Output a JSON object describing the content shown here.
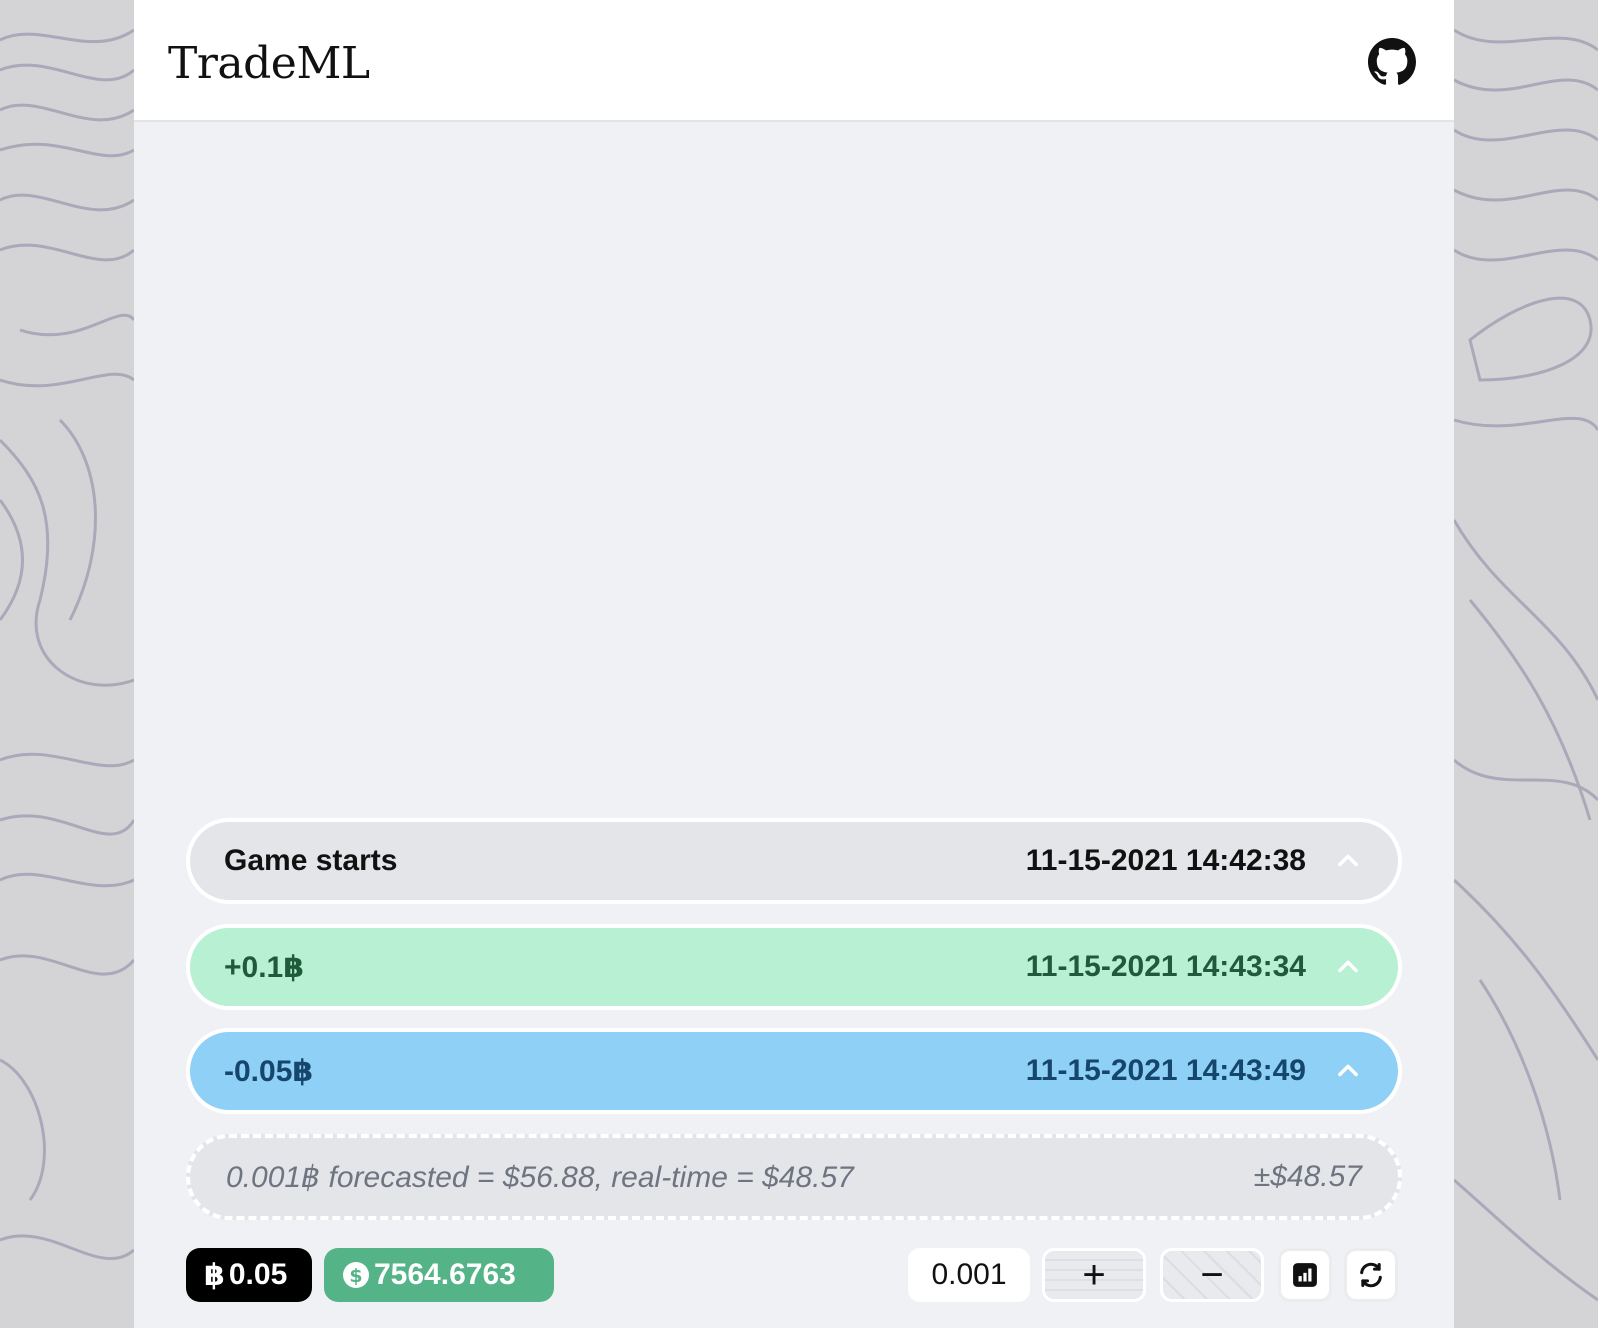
{
  "header": {
    "brand": "TradeML",
    "github_icon": "github-icon"
  },
  "events": [
    {
      "label": "Game starts",
      "time": "11-15-2021 14:42:38",
      "kind": "start"
    },
    {
      "label": "+0.1฿",
      "time": "11-15-2021 14:43:34",
      "kind": "buy"
    },
    {
      "label": "-0.05฿",
      "time": "11-15-2021 14:43:49",
      "kind": "sell"
    }
  ],
  "forecast": {
    "text": "0.001฿ forecasted = $56.88, real-time = $48.57",
    "delta": "±$48.57"
  },
  "wallet": {
    "btc_symbol": "฿",
    "btc_amount": "0.05",
    "usd_amount": "7564.6763"
  },
  "controls": {
    "quantity": "0.001",
    "plus_label": "+",
    "minus_label": "−",
    "chart_icon": "bar-chart-icon",
    "reset_icon": "refresh-icon"
  },
  "colors": {
    "start_bg": "#e4e5e9",
    "buy_bg": "#b7f0d2",
    "sell_bg": "#8fd0f6",
    "usd_pill": "#55b487",
    "btc_pill": "#000000"
  }
}
